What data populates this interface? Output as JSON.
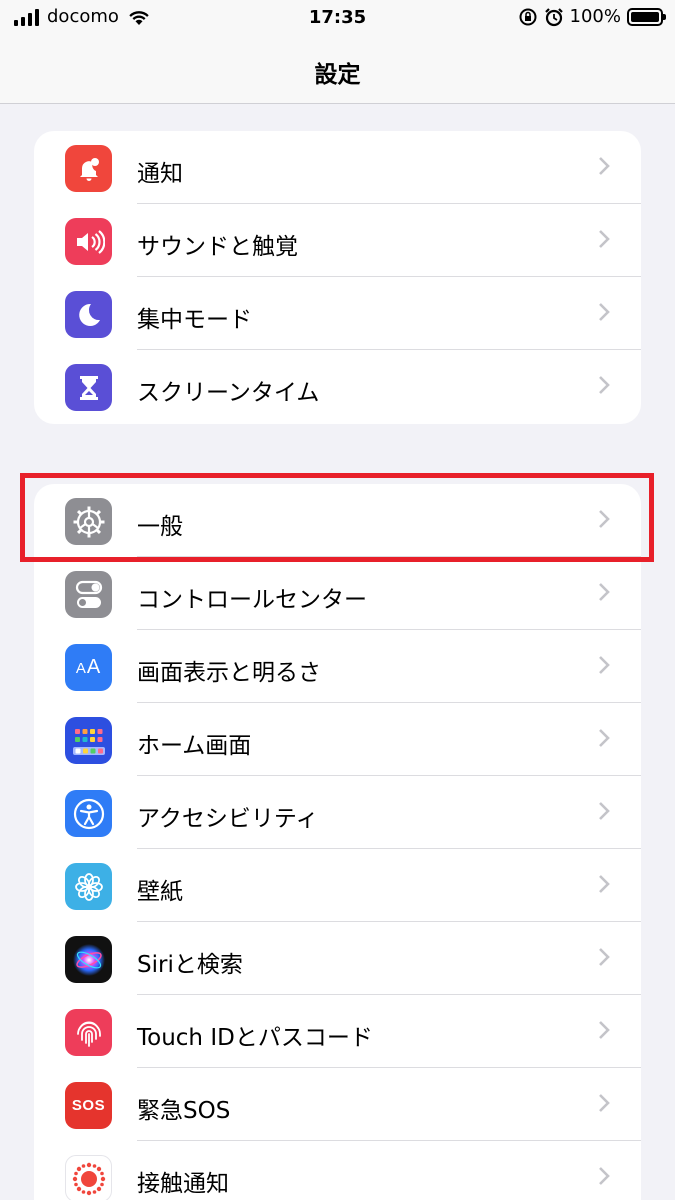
{
  "status_bar": {
    "carrier": "docomo",
    "time": "17:35",
    "battery_percent": "100%"
  },
  "nav": {
    "title": "設定"
  },
  "group1": [
    {
      "label": "通知",
      "icon": "notifications-icon",
      "color": "#f0463c"
    },
    {
      "label": "サウンドと触覚",
      "icon": "sounds-icon",
      "color": "#ee3d5a"
    },
    {
      "label": "集中モード",
      "icon": "focus-moon-icon",
      "color": "#5a4fd6"
    },
    {
      "label": "スクリーンタイム",
      "icon": "screen-time-icon",
      "color": "#5a4fd6"
    }
  ],
  "group2": [
    {
      "label": "一般",
      "icon": "gear-icon",
      "color": "#8e8e93"
    },
    {
      "label": "コントロールセンター",
      "icon": "control-center-icon",
      "color": "#8e8e93"
    },
    {
      "label": "画面表示と明るさ",
      "icon": "display-brightness-icon",
      "color": "#2f7cf6"
    },
    {
      "label": "ホーム画面",
      "icon": "home-screen-icon",
      "color": "#2d4fe0"
    },
    {
      "label": "アクセシビリティ",
      "icon": "accessibility-icon",
      "color": "#2f7cf6"
    },
    {
      "label": "壁紙",
      "icon": "wallpaper-icon",
      "color": "#3db0e6"
    },
    {
      "label": "Siriと検索",
      "icon": "siri-icon",
      "color": "#222"
    },
    {
      "label": "Touch IDとパスコード",
      "icon": "fingerprint-icon",
      "color": "#ee3d5a"
    },
    {
      "label": "緊急SOS",
      "icon": "sos-icon",
      "color": "#e5342d"
    },
    {
      "label": "接触通知",
      "icon": "exposure-notification-icon",
      "color": "#fff"
    }
  ],
  "highlight": {
    "color": "#e8202a",
    "target": "一般"
  }
}
